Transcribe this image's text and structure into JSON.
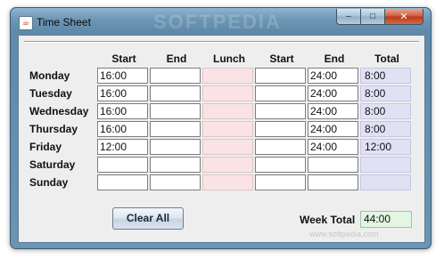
{
  "window": {
    "title": "Time Sheet",
    "watermark": "SOFTPEDIA",
    "watermark_url": "www.softpedia.com"
  },
  "caption_buttons": {
    "minimize": "–",
    "maximize": "□",
    "close": "✕"
  },
  "columns": [
    "Start",
    "End",
    "Lunch",
    "Start",
    "End",
    "Total"
  ],
  "days": [
    {
      "label": "Monday",
      "start": "16:00",
      "end": "",
      "lunch": "",
      "start2": "",
      "end2": "24:00",
      "total": "8:00"
    },
    {
      "label": "Tuesday",
      "start": "16:00",
      "end": "",
      "lunch": "",
      "start2": "",
      "end2": "24:00",
      "total": "8:00"
    },
    {
      "label": "Wednesday",
      "start": "16:00",
      "end": "",
      "lunch": "",
      "start2": "",
      "end2": "24:00",
      "total": "8:00"
    },
    {
      "label": "Thursday",
      "start": "16:00",
      "end": "",
      "lunch": "",
      "start2": "",
      "end2": "24:00",
      "total": "8:00"
    },
    {
      "label": "Friday",
      "start": "12:00",
      "end": "",
      "lunch": "",
      "start2": "",
      "end2": "24:00",
      "total": "12:00"
    },
    {
      "label": "Saturday",
      "start": "",
      "end": "",
      "lunch": "",
      "start2": "",
      "end2": "",
      "total": ""
    },
    {
      "label": "Sunday",
      "start": "",
      "end": "",
      "lunch": "",
      "start2": "",
      "end2": "",
      "total": ""
    }
  ],
  "footer": {
    "clear_label": "Clear All",
    "week_total_label": "Week Total",
    "week_total_value": "44:00"
  }
}
